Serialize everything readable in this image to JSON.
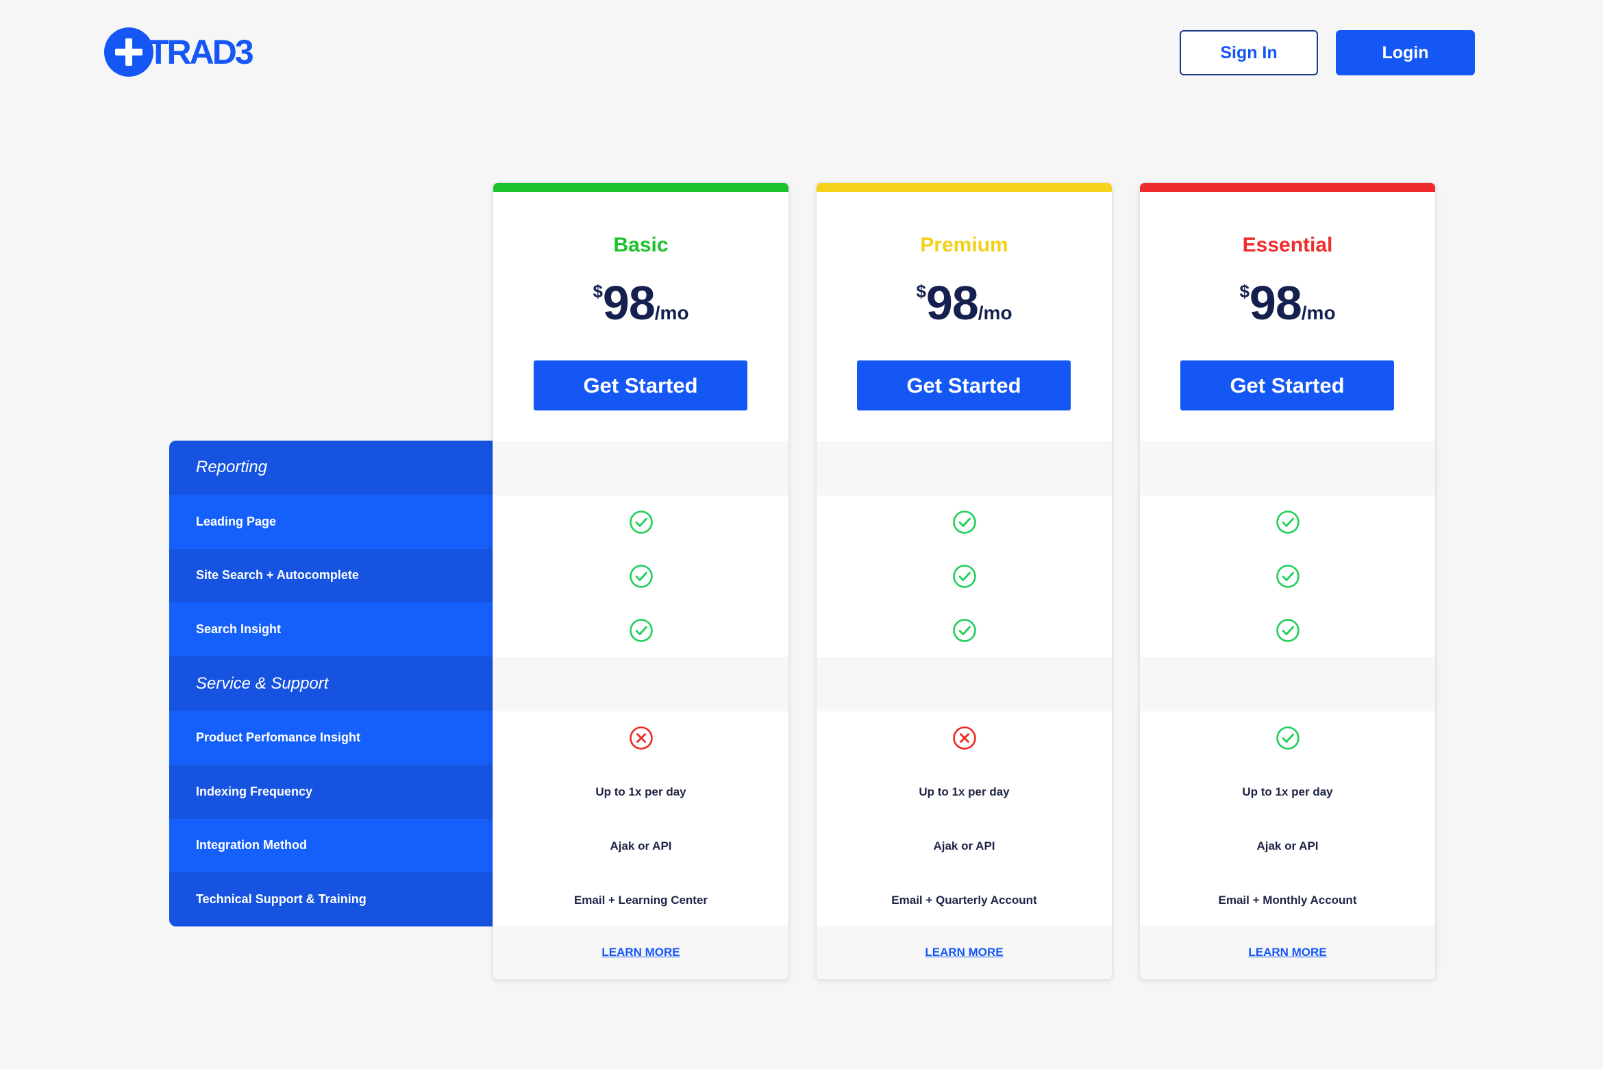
{
  "header": {
    "logo_text": "TRAD3",
    "signin_label": "Sign In",
    "login_label": "Login"
  },
  "colors": {
    "primary": "#1457f5",
    "basic": "#1bc22b",
    "premium": "#f5d21b",
    "essential": "#ef2b2b",
    "check": "#1fcf5a",
    "cross": "#ec2a1f"
  },
  "features": [
    {
      "label": "Reporting",
      "type": "category"
    },
    {
      "label": "Leading Page",
      "type": "feature"
    },
    {
      "label": "Site Search + Autocomplete",
      "type": "feature"
    },
    {
      "label": "Search Insight",
      "type": "feature"
    },
    {
      "label": "Service & Support",
      "type": "category"
    },
    {
      "label": "Product Perfomance Insight",
      "type": "feature"
    },
    {
      "label": "Indexing Frequency",
      "type": "feature"
    },
    {
      "label": "Integration Method",
      "type": "feature"
    },
    {
      "label": "Technical Support & Training",
      "type": "feature"
    }
  ],
  "plans": [
    {
      "name": "Basic",
      "currency": "$",
      "price": "98",
      "period": "/mo",
      "cta": "Get Started",
      "learn_more": "LEARN MORE",
      "cells": [
        "",
        "check-icon",
        "check-icon",
        "check-icon",
        "",
        "cross-icon",
        "Up to 1x per day",
        "Ajak or API",
        "Email + Learning Center"
      ]
    },
    {
      "name": "Premium",
      "currency": "$",
      "price": "98",
      "period": "/mo",
      "cta": "Get Started",
      "learn_more": "LEARN MORE",
      "cells": [
        "",
        "check-icon",
        "check-icon",
        "check-icon",
        "",
        "cross-icon",
        "Up to 1x per day",
        "Ajak or API",
        "Email + Quarterly Account"
      ]
    },
    {
      "name": "Essential",
      "currency": "$",
      "price": "98",
      "period": "/mo",
      "cta": "Get Started",
      "learn_more": "LEARN MORE",
      "cells": [
        "",
        "check-icon",
        "check-icon",
        "check-icon",
        "",
        "check-icon",
        "Up to 1x per day",
        "Ajak or API",
        "Email + Monthly Account"
      ]
    }
  ]
}
